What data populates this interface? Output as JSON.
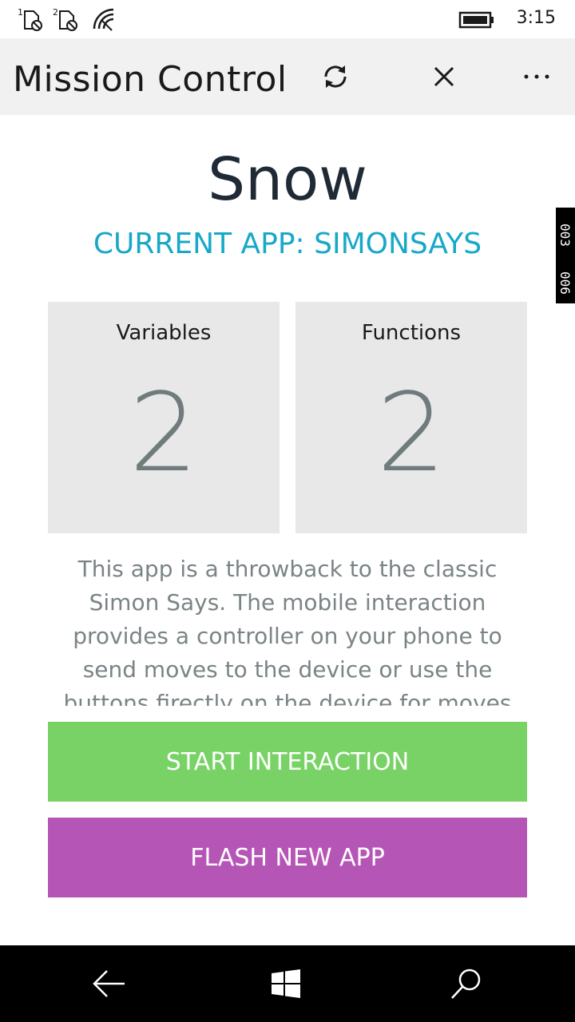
{
  "status_bar": {
    "sim1_label": "1",
    "sim2_label": "2",
    "time": "3:15",
    "icons": [
      "sim-no-service-icon",
      "sim-no-service-icon",
      "wifi-icon",
      "battery-icon"
    ]
  },
  "app_bar": {
    "title": "Mission Control",
    "icons": [
      "sync-icon",
      "close-icon",
      "more-icon"
    ]
  },
  "device": {
    "name": "Snow",
    "current_app": "CURRENT APP: SIMONSAYS"
  },
  "side_tag": {
    "top": "003",
    "bottom": "006"
  },
  "stats": {
    "variables_label": "Variables",
    "variables_value": "2",
    "functions_label": "Functions",
    "functions_value": "2"
  },
  "description": "This app is a throwback to the classic Simon Says. The mobile interaction provides a controller on your phone to send moves to the device or use the buttons firectly on the device for moves",
  "actions": {
    "start_label": "START INTERACTION",
    "flash_label": "FLASH NEW APP"
  },
  "nav_bar": {
    "icons": [
      "back-arrow-icon",
      "windows-logo-icon",
      "search-icon"
    ]
  },
  "colors": {
    "accent": "#17a8c8",
    "start_button": "#78d265",
    "flash_button": "#b556b7",
    "card_background": "#e8e8e8",
    "app_bar_background": "#f1f1f1"
  }
}
